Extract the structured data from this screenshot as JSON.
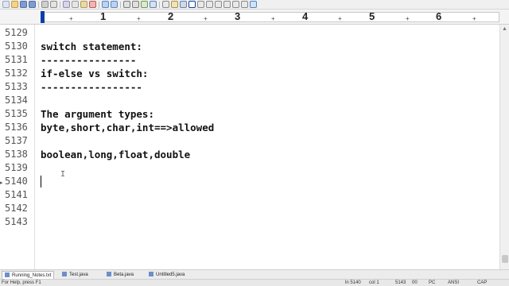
{
  "toolbar": {
    "colors": {
      "accent": "#0b3fa8"
    }
  },
  "ruler": {
    "numbers": [
      "1",
      "2",
      "3",
      "4",
      "5",
      "6"
    ],
    "tick": "+"
  },
  "editor": {
    "lines": [
      {
        "no": "5129",
        "text": ""
      },
      {
        "no": "5130",
        "text": "switch statement:"
      },
      {
        "no": "5131",
        "text": "----------------"
      },
      {
        "no": "5132",
        "text": "if-else vs switch:"
      },
      {
        "no": "5133",
        "text": "-----------------"
      },
      {
        "no": "5134",
        "text": ""
      },
      {
        "no": "5135",
        "text": "The argument types:"
      },
      {
        "no": "5136",
        "text": "byte,short,char,int==>allowed"
      },
      {
        "no": "5137",
        "text": ""
      },
      {
        "no": "5138",
        "text": "boolean,long,float,double"
      },
      {
        "no": "5139",
        "text": ""
      },
      {
        "no": "5140",
        "text": ""
      },
      {
        "no": "5141",
        "text": ""
      },
      {
        "no": "5142",
        "text": ""
      },
      {
        "no": "5143",
        "text": ""
      }
    ]
  },
  "tabs": [
    {
      "label": "Running_Notes.txt",
      "active": true
    },
    {
      "label": "Test.java",
      "active": false
    },
    {
      "label": "Beta.java",
      "active": false
    },
    {
      "label": "Untitled5.java",
      "active": false
    }
  ],
  "status": {
    "help": "For Help, press F1",
    "line": "ln 5140",
    "col": "col 1",
    "total": "5143",
    "zero": "00",
    "eol": "PC",
    "encoding": "ANSI",
    "caps": "CAP"
  }
}
